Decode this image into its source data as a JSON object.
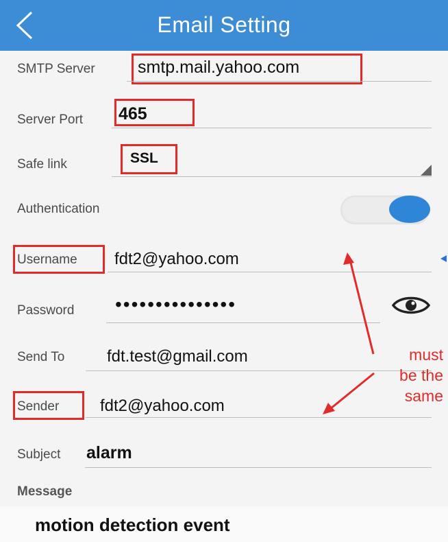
{
  "header": {
    "title": "Email Setting"
  },
  "fields": {
    "smtp_server": {
      "label": "SMTP Server",
      "value": "smtp.mail.yahoo.com"
    },
    "server_port": {
      "label": "Server Port",
      "value": "465"
    },
    "safe_link": {
      "label": "Safe link",
      "value": "SSL"
    },
    "authentication": {
      "label": "Authentication",
      "enabled": true
    },
    "username": {
      "label": "Username",
      "value": "fdt2@yahoo.com"
    },
    "password": {
      "label": "Password",
      "value": "•••••••••••••••"
    },
    "send_to": {
      "label": "Send To",
      "value": "fdt.test@gmail.com"
    },
    "sender": {
      "label": "Sender",
      "value": "fdt2@yahoo.com"
    },
    "subject": {
      "label": "Subject",
      "value": "alarm"
    },
    "message": {
      "label": "Message",
      "value": "motion detection event"
    }
  },
  "annotation": {
    "line1": "must",
    "line2": "be the",
    "line3": "same"
  },
  "colors": {
    "header": "#3d8cd6",
    "highlight": "#e12b2b",
    "toggle_on": "#2f86d8"
  },
  "icons": {
    "back": "chevron-left-icon",
    "show_password": "eye-icon",
    "dropdown": "dropdown-triangle-icon"
  }
}
